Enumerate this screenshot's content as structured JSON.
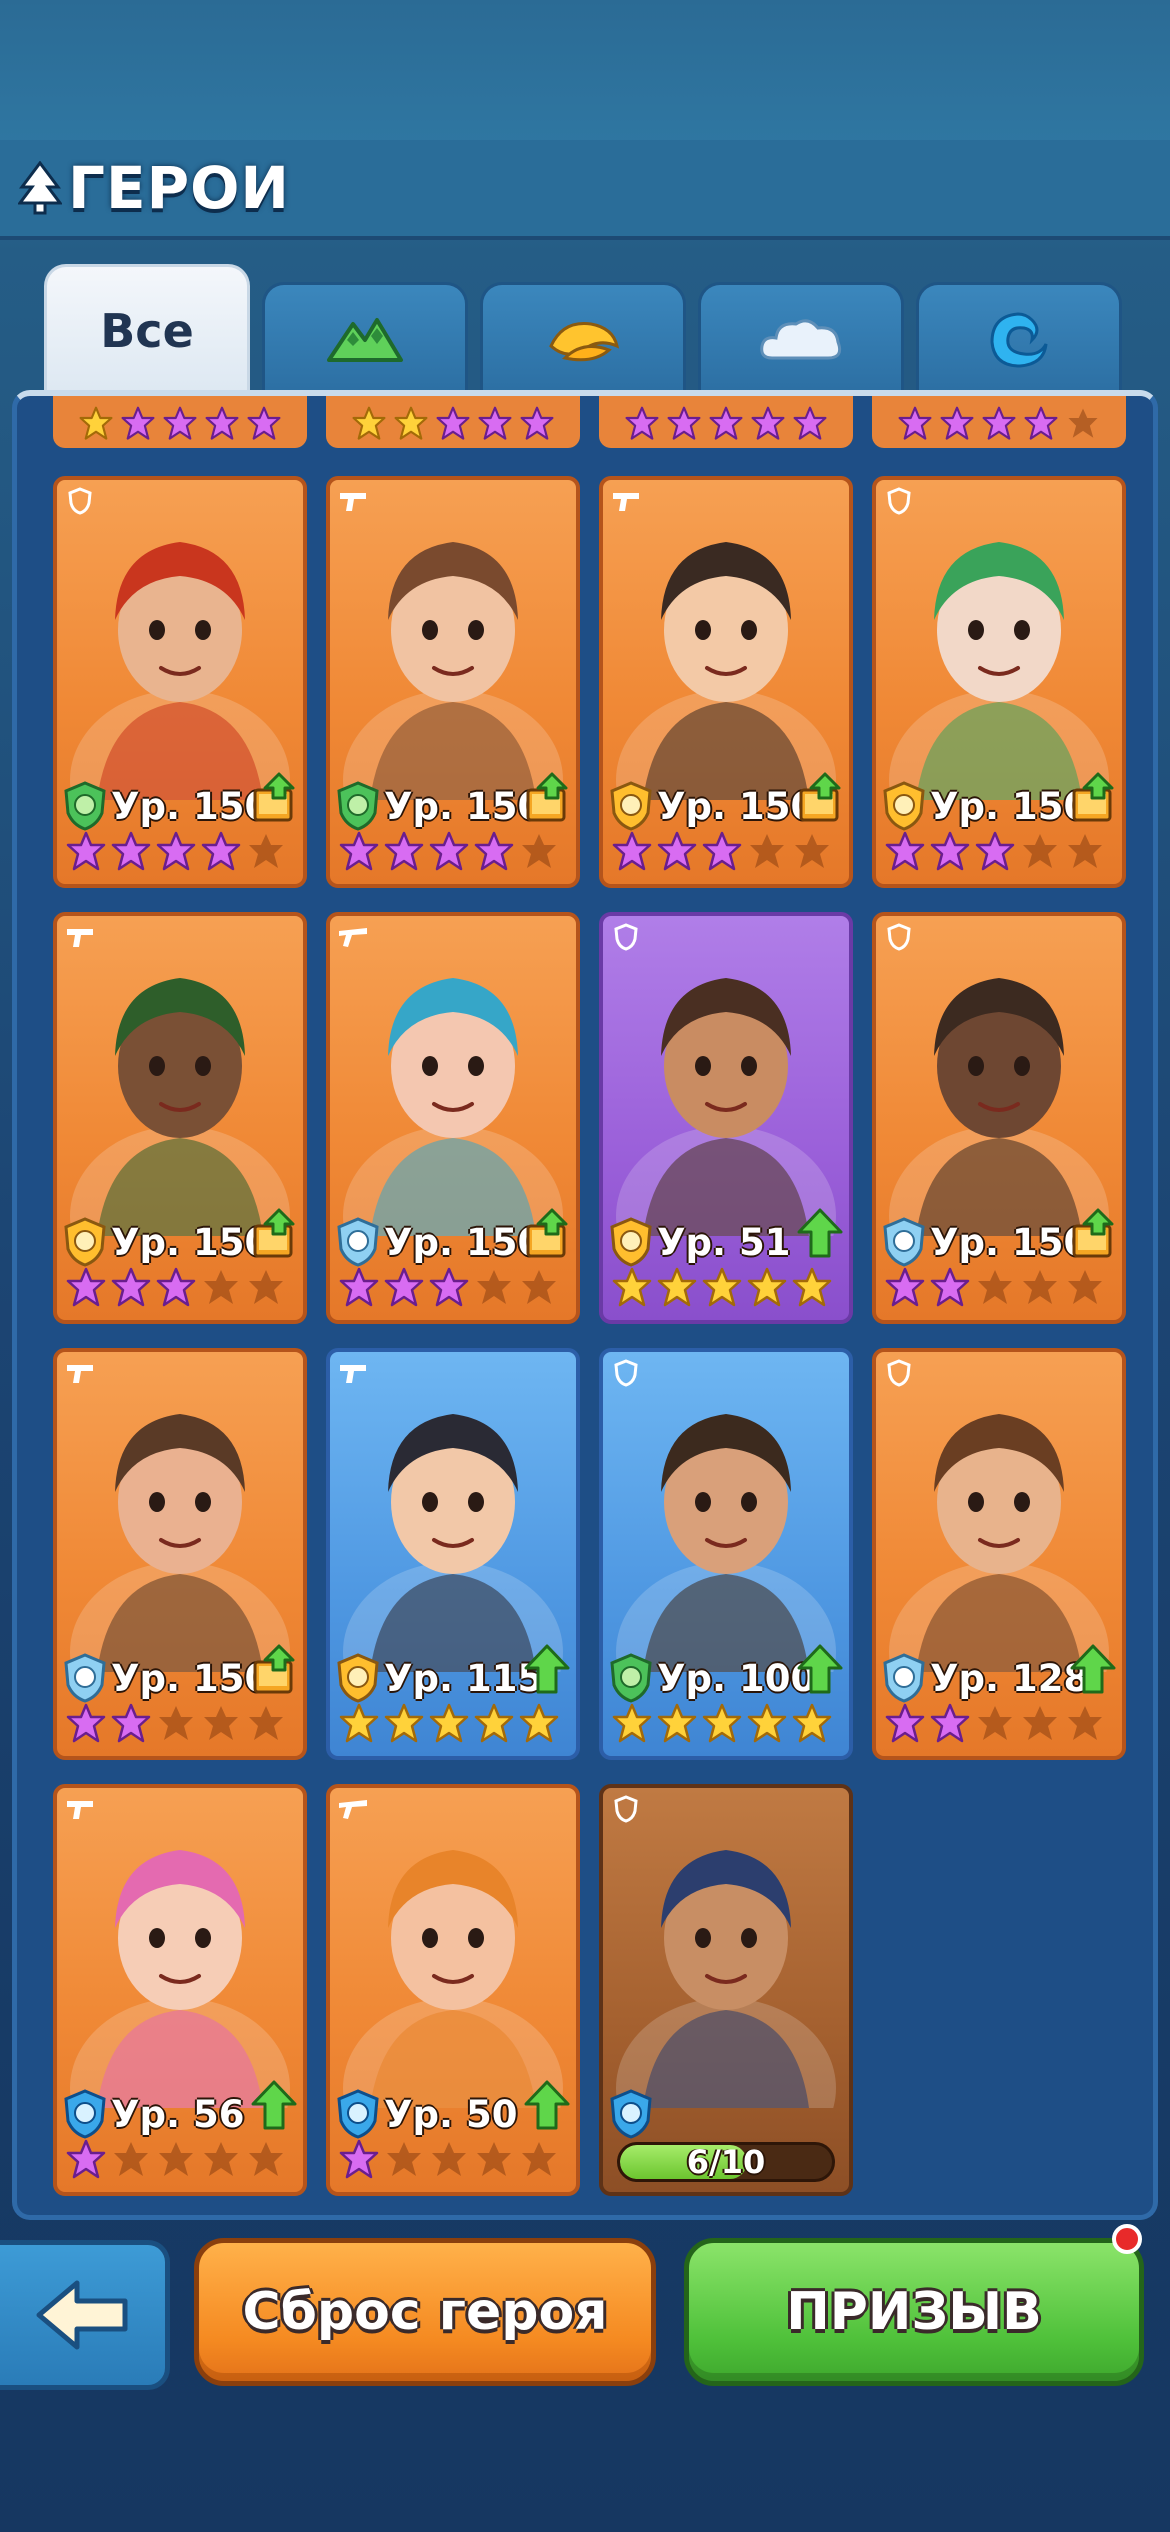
{
  "header": {
    "title": "ГЕРОИ",
    "title_icon": "tree-icon"
  },
  "tabs": [
    {
      "label": "Все",
      "icon": "",
      "active": true
    },
    {
      "label": "",
      "icon": "mountain-icon",
      "active": false
    },
    {
      "label": "",
      "icon": "desert-icon",
      "active": false
    },
    {
      "label": "",
      "icon": "cloud-icon",
      "active": false
    },
    {
      "label": "",
      "icon": "wave-icon",
      "active": false
    }
  ],
  "heroes": [
    {
      "role": "shield",
      "element": "mountain",
      "level": "Ур. 150",
      "stars": 4,
      "star_color": "purple",
      "upgrade": "book"
    },
    {
      "role": "gun",
      "element": "mountain",
      "level": "Ур. 150",
      "stars": 4,
      "star_color": "purple",
      "upgrade": "book"
    },
    {
      "role": "gun",
      "element": "desert",
      "level": "Ур. 150",
      "stars": 3,
      "star_color": "purple",
      "upgrade": "book"
    },
    {
      "role": "shield",
      "element": "desert",
      "level": "Ур. 150",
      "stars": 3,
      "star_color": "purple",
      "upgrade": "book"
    },
    {
      "role": "gun",
      "element": "desert",
      "level": "Ур. 150",
      "stars": 3,
      "star_color": "purple",
      "upgrade": "book"
    },
    {
      "role": "rifle",
      "element": "cloud",
      "level": "Ур. 150",
      "stars": 3,
      "star_color": "purple",
      "upgrade": "book"
    },
    {
      "role": "shield",
      "element": "desert",
      "level": "Ур. 51",
      "stars": 5,
      "star_color": "gold",
      "upgrade": "arrow",
      "rarity": "purple"
    },
    {
      "role": "shield",
      "element": "cloud",
      "level": "Ур. 150",
      "stars": 2,
      "star_color": "purple",
      "upgrade": "book"
    },
    {
      "role": "gun",
      "element": "cloud",
      "level": "Ур. 150",
      "stars": 2,
      "star_color": "purple",
      "upgrade": "book"
    },
    {
      "role": "gun",
      "element": "desert",
      "level": "Ур. 115",
      "stars": 5,
      "star_color": "gold",
      "upgrade": "arrow",
      "rarity": "blue"
    },
    {
      "role": "shield",
      "element": "mountain",
      "level": "Ур. 100",
      "stars": 5,
      "star_color": "gold",
      "upgrade": "arrow",
      "rarity": "blue"
    },
    {
      "role": "shield",
      "element": "cloud",
      "level": "Ур. 128",
      "stars": 2,
      "star_color": "purple",
      "upgrade": "arrow"
    },
    {
      "role": "gun",
      "element": "wave",
      "level": "Ур. 56",
      "stars": 1,
      "star_color": "purple",
      "upgrade": "arrow"
    },
    {
      "role": "rifle",
      "element": "wave",
      "level": "Ур. 50",
      "stars": 1,
      "star_color": "purple",
      "upgrade": "arrow"
    },
    {
      "role": "shield",
      "element": "wave",
      "level": "",
      "stars": 0,
      "locked": true,
      "shards": "6/10",
      "shard_progress": 0.6
    }
  ],
  "buttons": {
    "back_icon": "arrow-left-icon",
    "reset": "Сброс героя",
    "summon": "ПРИЗЫВ"
  },
  "colors": {
    "orange_card": "#f08936",
    "purple_card": "#9a5fd9",
    "blue_card": "#4f98e2",
    "reset_button": "#f58a21",
    "summon_button": "#4fc13a",
    "notification": "#e82a2a"
  }
}
